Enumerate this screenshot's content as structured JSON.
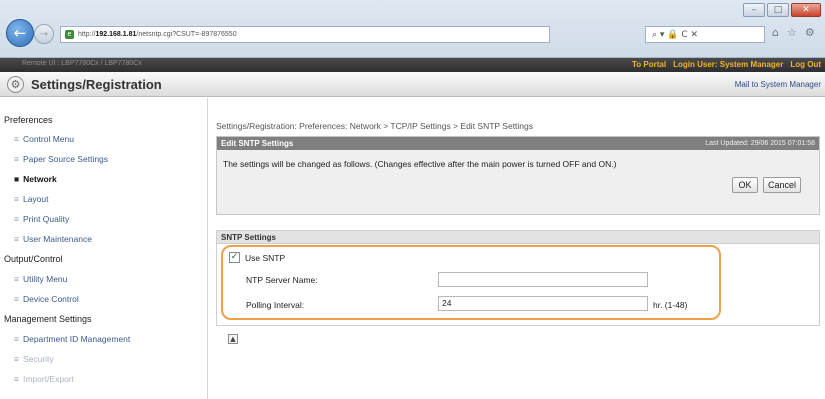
{
  "browser": {
    "url_prefix": "http://",
    "url_host": "192.168.1.81",
    "url_rest": "/netsntp.cgi?CSUT=-897876550",
    "addr_tools": "⌕ ▾ 🔒 C ✕",
    "win_min": "–",
    "win_max": "□",
    "win_close": "✕"
  },
  "portal_bar": {
    "brand": "Remote UI   :   LBP7780Cx / LBP7780Cx",
    "to_portal": "To Portal",
    "login_user": "Login User: System Manager",
    "logout": "Log Out"
  },
  "header": {
    "title": "Settings/Registration",
    "mail_link": "Mail to System Manager"
  },
  "sidebar": {
    "groups": [
      {
        "label": "Preferences"
      },
      {
        "label": "Output/Control"
      },
      {
        "label": "Management Settings"
      }
    ],
    "items": [
      {
        "label": "Control Menu"
      },
      {
        "label": "Paper Source Settings"
      },
      {
        "label": "Network"
      },
      {
        "label": "Layout"
      },
      {
        "label": "Print Quality"
      },
      {
        "label": "User Maintenance"
      },
      {
        "label": "Utility Menu"
      },
      {
        "label": "Device Control"
      },
      {
        "label": "Department ID Management"
      },
      {
        "label": "Security"
      },
      {
        "label": "Import/Export"
      }
    ]
  },
  "main": {
    "breadcrumb": "Settings/Registration: Preferences: Network > TCP/IP Settings > Edit SNTP Settings",
    "edit_panel": {
      "title": "Edit SNTP Settings",
      "last_updated": "Last Updated: 29/06 2015 07:01:58",
      "notice": "The settings will be changed as follows. (Changes effective after the main power is turned OFF and ON.)",
      "ok_label": "OK",
      "cancel_label": "Cancel"
    },
    "sntp_panel": {
      "title": "SNTP Settings",
      "use_sntp_label": "Use SNTP",
      "use_sntp_checked": true,
      "ntp_server_label": "NTP Server Name:",
      "ntp_server_value": "",
      "polling_label": "Polling Interval:",
      "polling_value": "24",
      "polling_unit": "hr. (1-48)"
    }
  }
}
